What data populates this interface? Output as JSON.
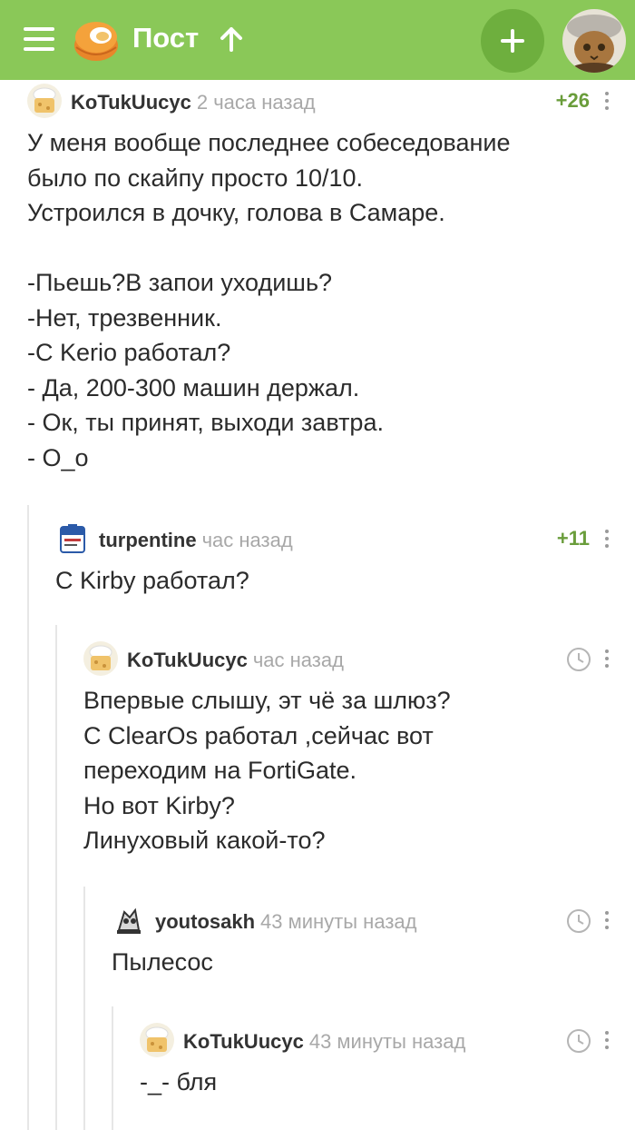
{
  "header": {
    "title": "Пост",
    "icons": {
      "menu": "menu-icon",
      "logo": "pikabu-logo",
      "up": "arrow-up-icon",
      "add": "plus-icon"
    },
    "accent_color": "#8ac858"
  },
  "comments": [
    {
      "username": "KoTukUucyc",
      "time": "2 часа назад",
      "rating": "+26",
      "text": "У меня вообще последнее собеседование\nбыло по скайпу просто 10/10.\nУстроился в дочку, голова в Самаре.\n\n-Пьешь?В запои уходишь?\n-Нет, трезвенник.\n-С Kerio работал?\n- Да, 200-300 машин держал.\n- Ок, ты принят, выходи завтра.\n- О_о"
    },
    {
      "username": "turpentine",
      "time": "час назад",
      "rating": "+11",
      "text": "С Kirby работал?"
    },
    {
      "username": "KoTukUucyc",
      "time": "час назад",
      "text": "Впервые слышу, эт чё за шлюз?\nС ClearOs работал ,сейчас вот\nпереходим на FortiGate.\nНо вот Kirby?\nЛинуховый какой-то?"
    },
    {
      "username": "youtosakh",
      "time": "43 минуты назад",
      "text": "Пылесос"
    },
    {
      "username": "KoTukUucyc",
      "time": "43 минуты назад",
      "text": "-_- бля"
    }
  ]
}
